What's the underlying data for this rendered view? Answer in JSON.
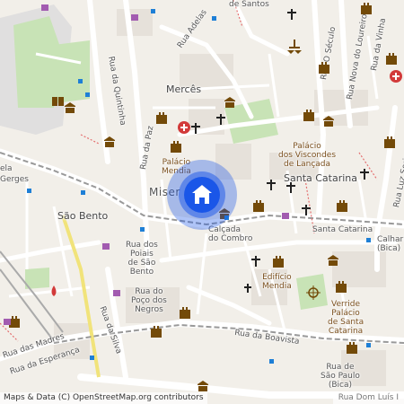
{
  "map": {
    "place_labels": {
      "merces": "Mercês",
      "miser": "Miser",
      "sao_bento": "São Bento",
      "santa_catarina": "Santa Catarina",
      "calhariz": "Calhariz\n(Bica)",
      "santos": "de Santos"
    },
    "street_labels": {
      "rua_adelas": "Rua Adelas",
      "rua_da_quintinha": "Rua da Quintinha",
      "rua_da_paz": "Rua da Paz",
      "rua_o_seculo": "Rua O Século",
      "rua_vinha": "Rua da Vinha",
      "rua_nova_loureiro": "Rua Nova do Loureiro",
      "rua_luz_soriano": "Rua Luz Soriano",
      "rua_dos_poiais": "Rua dos\nPoiais\nde São\nBento",
      "rua_poco_negros": "Rua do\nPoço dos\nNegros",
      "rua_da_silva": "Rua da Silva",
      "calcada_combro": "Calçada\ndo Combro",
      "santa_catarina_street": "Santa Catarina",
      "rua_boavista": "Rua da Boavista",
      "rua_madres": "Rua das Madres",
      "rua_esperanca": "Rua da Esperança",
      "rua_dom_luis": "Rua Dom Luís I",
      "rua_gerges": "Gerges",
      "rua_ela": "ela"
    },
    "poi_labels": {
      "palacio_mendia": "Palácio\nMendia",
      "palacio_viscondes": "Palácio\ndos Viscondes\nde Lançada",
      "edificio_mendia": "Edifício\nMendia",
      "verride": "Verride\nPalácio\nde Santa\nCatarina",
      "rua_sao_paulo": "Rua de\nSão Paulo\n(Bica)"
    },
    "attribution": "Maps & Data (C) OpenStreetMap.org contributors",
    "marker_icon": "home-icon",
    "colors": {
      "background": "#f2efe9",
      "road": "#ffffff",
      "park": "#c8e3b6",
      "railway": "#999999",
      "tram": "#f1e37a",
      "marker_blue": "#1a56e8",
      "hospital": "#d23a3a",
      "poi_brown": "#734a08"
    }
  }
}
